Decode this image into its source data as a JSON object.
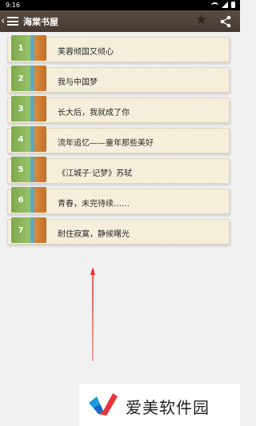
{
  "status_bar": {
    "time": "9:16"
  },
  "app_bar": {
    "title": "海棠书屋",
    "back_icon": "chevron-left-icon",
    "menu_icon": "hamburger-menu-icon",
    "star_icon": "star-icon",
    "share_icon": "share-icon"
  },
  "books": [
    {
      "number": "1",
      "title": "芙蓉倾国又倾心"
    },
    {
      "number": "2",
      "title": "我与中国梦"
    },
    {
      "number": "3",
      "title": "长大后，我就成了你"
    },
    {
      "number": "4",
      "title": "流年追忆——童年那些美好"
    },
    {
      "number": "5",
      "title": "《江城子·记梦》苏轼"
    },
    {
      "number": "6",
      "title": "青春，未完待续……"
    },
    {
      "number": "7",
      "title": "耐住寂寞，静候曙光"
    }
  ],
  "ad": {
    "text": "爱美软件园"
  },
  "colors": {
    "app_bar": "#463a32",
    "spine_green": "#7da84d",
    "spine_blue": "#5aa9c4",
    "spine_orange": "#d98a3a",
    "arrow": "#e8352b"
  }
}
